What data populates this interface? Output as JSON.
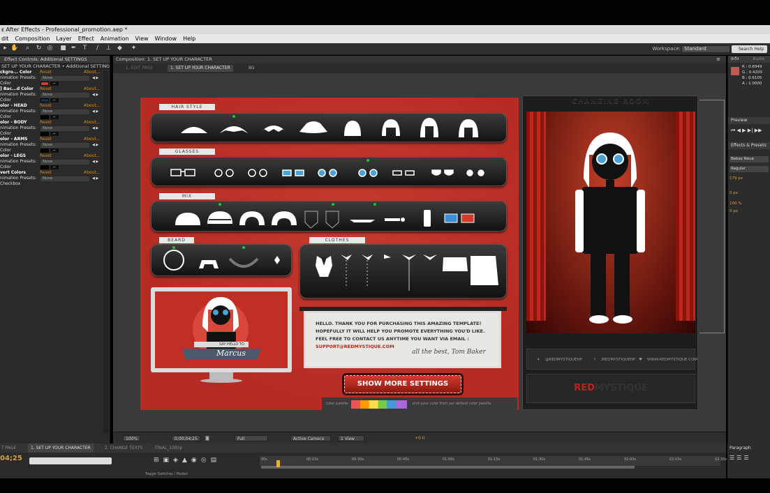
{
  "window": {
    "title": "ᴇ After Effects - Professional_promotion.aep *"
  },
  "menu": [
    "dit",
    "Composition",
    "Layer",
    "Effect",
    "Animation",
    "View",
    "Window",
    "Help"
  ],
  "toolbar": {
    "workspace_label": "Workspace:",
    "workspace_value": "Standard",
    "search_placeholder": "Search Help"
  },
  "effect_controls": {
    "panel_title": "Effect Controls: Additional SETTINGS",
    "breadcrumb": "SET UP YOUR CHARACTER • Additional SETTINGS",
    "groups": [
      {
        "name": "ckgro... Color",
        "presets": "None",
        "color": "#d43b2e"
      },
      {
        "name": "] Bac...d Color",
        "presets": "None",
        "color": "#16324d"
      },
      {
        "name": "olor - HEAD",
        "presets": "None",
        "color": "#000000"
      },
      {
        "name": "olor - BODY",
        "presets": "None",
        "color": "#000000"
      },
      {
        "name": "olor - ARMS",
        "presets": "None",
        "color": "#000000"
      },
      {
        "name": "olor - LEGS",
        "presets": "None",
        "color": "#000000"
      },
      {
        "name": "vert Colors",
        "presets": "None"
      }
    ],
    "reset": "Reset",
    "about": "About...",
    "presets_label": "nimation Presets:",
    "color_label": "Color",
    "checkbox_label": "Checkbox"
  },
  "composition": {
    "tab": "Composition: 1. SET UP YOUR CHARACTER",
    "subtabs": [
      "1. EDIT PAGE",
      "1. SET UP YOUR CHARACTER",
      "BG"
    ]
  },
  "viewer_controls": {
    "zoom": "100%",
    "timecode": "0;00;04;25",
    "resolution": "Full",
    "camera": "Active Camera",
    "view": "1 View",
    "offset": "+0.0"
  },
  "info": {
    "title": "Info",
    "audio": "Audio",
    "r": "R : 0.6949",
    "g": "G : 0.4200",
    "b": "B : 0.6105",
    "a": "A : 1.0000",
    "swatch": "#c05a50"
  },
  "preview": {
    "title": "Preview"
  },
  "effects_presets": {
    "title": "Effects & Presets"
  },
  "character_panel": {
    "font": "Bebas Neue",
    "style": "Regular",
    "size": "179 px",
    "leading": "0 px",
    "scale": "100 %",
    "baseline": "0 px"
  },
  "paragraph": {
    "title": "Paragraph"
  },
  "timeline": {
    "tabs": [
      "T PAGE",
      "1. SET UP YOUR CHARACTER",
      "2. CHANGE TEXTS",
      "FINAL_1080p"
    ],
    "timecode": "04;25",
    "ticks": [
      "00s",
      "00:15s",
      "00:30s",
      "00:45s",
      "01:00s",
      "01:15s",
      "01:30s",
      "01:45s",
      "02:00s",
      "02:15s",
      "02:30s"
    ],
    "toggle": "Toggle Switches / Modes"
  },
  "artwork": {
    "sections": [
      "HAIR STYLE",
      "GLASSES",
      "MIX",
      "BEARD",
      "CLOTHES"
    ],
    "monitor_name": "Marcus",
    "monitor_tag": "SAY HELLO TO",
    "message": "HELLO. THANK YOU FOR PURCHASING THIS AMAZING TEMPLATE! HOPEFULLY IT WILL HELP YOU PROMOTE EVERYTHING YOU'D LIKE. FEEL FREE TO CONTACT US ANYTIME YOU WANT VIA EMAIL :",
    "email": "SUPPORT@REDMYSTIQUE.COM",
    "signature": "all the best, Tom Baker",
    "button": "SHOW MORE SETTINGS",
    "palette_left": "color palette",
    "palette_right": "pick your color from our default color palette",
    "changing_room": "CHANGING ROOM",
    "social": [
      "@REDMYSTIQUEHP",
      "/REDMYSTIQUEHP",
      "WWW.REDMYSTIQUE.COM"
    ],
    "brand_a": "RED",
    "brand_b": "MYSTIQUE"
  }
}
